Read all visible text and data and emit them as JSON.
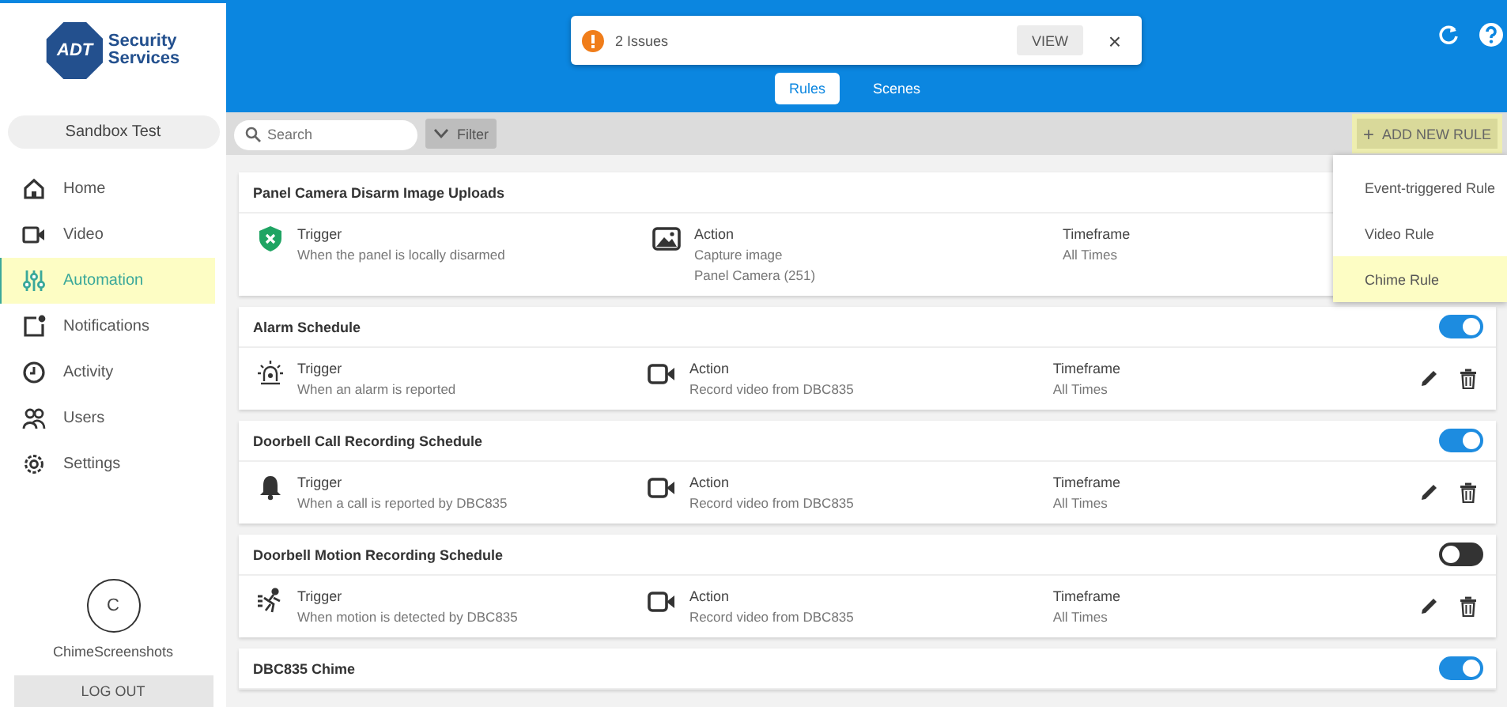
{
  "logo": {
    "mark": "ADT",
    "line_1": "Security",
    "line_2": "Services"
  },
  "site": "Sandbox Test",
  "nav": [
    {
      "label": "Home",
      "selected": false
    },
    {
      "label": "Video",
      "selected": false
    },
    {
      "label": "Automation",
      "selected": true
    },
    {
      "label": "Notifications",
      "selected": false
    },
    {
      "label": "Activity",
      "selected": false
    },
    {
      "label": "Users",
      "selected": false
    },
    {
      "label": "Settings",
      "selected": false
    }
  ],
  "user": {
    "initial": "C",
    "name": "ChimeScreenshots"
  },
  "logout": "LOG OUT",
  "alert": {
    "text": "2 Issues",
    "button": "VIEW",
    "close": "×"
  },
  "tabs": [
    {
      "label": "Rules",
      "selected": true
    },
    {
      "label": "Scenes",
      "selected": false
    }
  ],
  "search": {
    "placeholder": "Search"
  },
  "filter": "Filter",
  "add_button": {
    "icon": "+",
    "label": "ADD NEW RULE",
    "highlighted": true
  },
  "add_menu": [
    {
      "label": "Event-triggered Rule",
      "highlighted": false
    },
    {
      "label": "Video Rule",
      "highlighted": false
    },
    {
      "label": "Chime Rule",
      "highlighted": true
    }
  ],
  "rules": [
    {
      "title": "Panel Camera Disarm Image Uploads",
      "trigger_label": "Trigger",
      "trigger_text": "When the panel is locally disarmed",
      "action_label": "Action",
      "action_lines": [
        "Capture image",
        "Panel Camera (251)"
      ],
      "timeframe_label": "Timeframe",
      "timeframe": "All Times"
    },
    {
      "title": "Alarm Schedule",
      "on": true,
      "trigger_label": "Trigger",
      "trigger_text": "When an alarm is reported",
      "action_label": "Action",
      "action_lines": [
        "Record video from DBC835"
      ],
      "timeframe_label": "Timeframe",
      "timeframe": "All Times"
    },
    {
      "title": "Doorbell Call Recording Schedule",
      "on": true,
      "trigger_label": "Trigger",
      "trigger_text": "When a call is reported by DBC835",
      "action_label": "Action",
      "action_lines": [
        "Record video from DBC835"
      ],
      "timeframe_label": "Timeframe",
      "timeframe": "All Times"
    },
    {
      "title": "Doorbell Motion Recording Schedule",
      "on": false,
      "trigger_label": "Trigger",
      "trigger_text": "When motion is detected by DBC835",
      "action_label": "Action",
      "action_lines": [
        "Record video from DBC835"
      ],
      "timeframe_label": "Timeframe",
      "timeframe": "All Times"
    },
    {
      "title": "DBC835 Chime",
      "on": true
    }
  ]
}
